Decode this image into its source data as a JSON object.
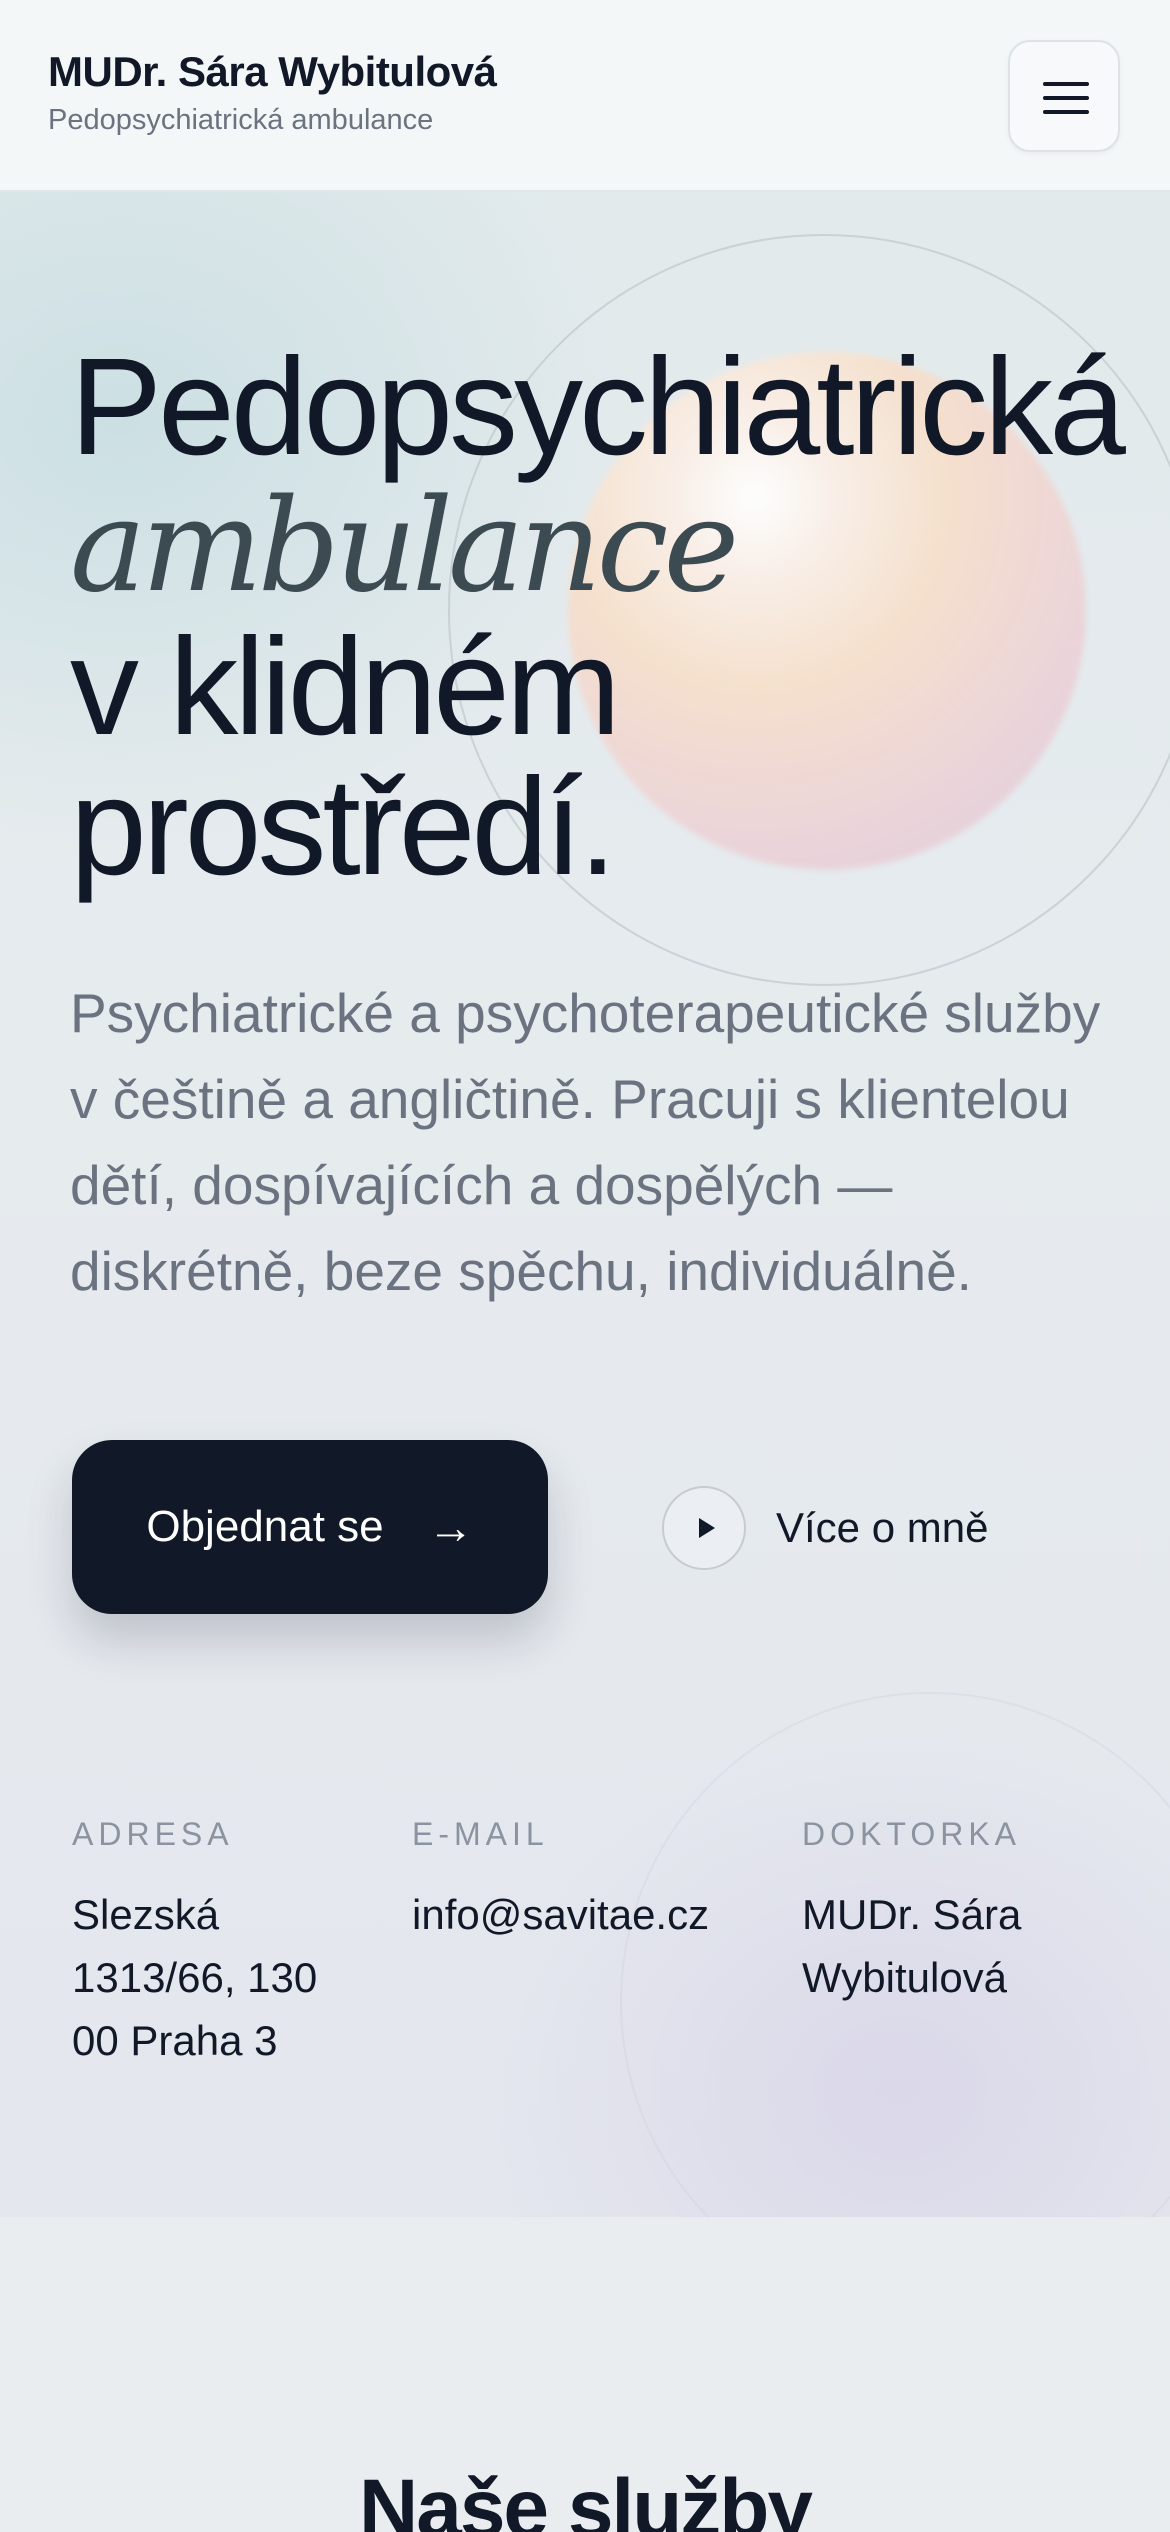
{
  "header": {
    "name": "MUDr. Sára Wybitulová",
    "subtitle": "Pedopsychiatrická ambulance",
    "menu_icon": "hamburger-menu-icon"
  },
  "hero": {
    "title_line1": "Pedopsychiatrická",
    "title_line2": "ambulance",
    "title_line3": "v klidném",
    "title_line4": "prostředí.",
    "lead": "Psychiatrické a psychoterapeutické služby v češtině a angličtině. Pracuji s klientelou dětí, dospívajících a dospělých — diskrétně, beze spěchu, individuálně.",
    "cta_primary": "Objednat se",
    "cta_primary_icon": "arrow-right-icon",
    "cta_secondary": "Více o mně",
    "cta_secondary_icon": "play-icon"
  },
  "info": {
    "address_label": "ADRESA",
    "address_line1": "Slezská",
    "address_line2": "1313/66, 130",
    "address_line3": "00 Praha 3",
    "email_label": "E-MAIL",
    "email_value": "info@savitae.cz",
    "doctor_label": "DOKTORKA",
    "doctor_line1": "MUDr. Sára",
    "doctor_line2": "Wybitulová"
  },
  "services": {
    "title": "Naše služby"
  },
  "colors": {
    "primary_dark": "#111827",
    "muted_text": "#6b7280",
    "label_gray": "#8b93a0",
    "background": "#e9edf0"
  }
}
